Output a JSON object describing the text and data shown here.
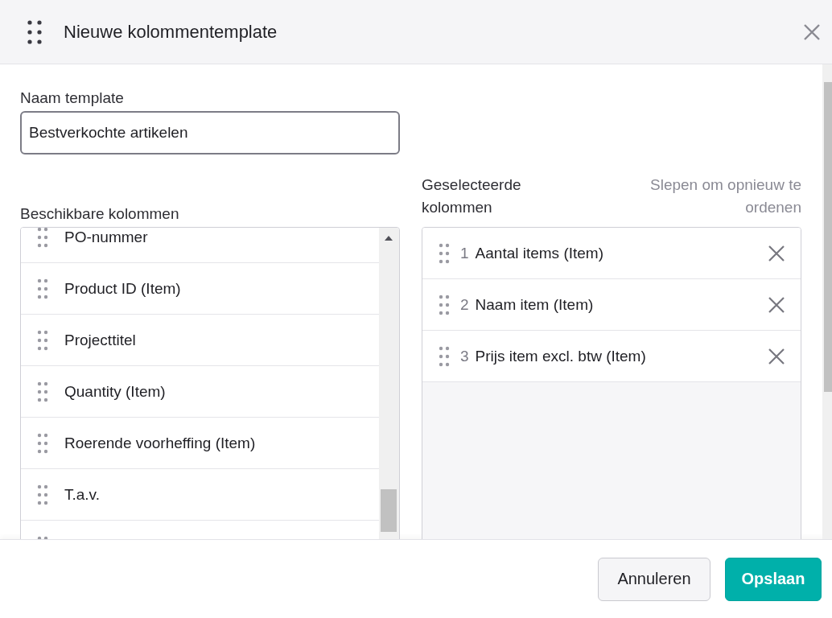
{
  "dialog": {
    "title": "Nieuwe kolommentemplate"
  },
  "template_name": {
    "label": "Naam template",
    "value": "Bestverkochte artikelen"
  },
  "available": {
    "label": "Beschikbare kolommen",
    "items": [
      {
        "label": "PO-nummer"
      },
      {
        "label": "Product ID (Item)"
      },
      {
        "label": "Projecttitel"
      },
      {
        "label": "Quantity (Item)"
      },
      {
        "label": "Roerende voorheffing (Item)"
      },
      {
        "label": "T.a.v."
      }
    ]
  },
  "selected": {
    "label": "Geselecteerde kolommen",
    "hint": "Slepen om opnieuw te ordenen",
    "items": [
      {
        "number": "1",
        "label": "Aantal items (Item)"
      },
      {
        "number": "2",
        "label": "Naam item (Item)"
      },
      {
        "number": "3",
        "label": "Prijs item excl. btw (Item)"
      }
    ]
  },
  "buttons": [
    {
      "label": "Annuleren",
      "kind": "secondary"
    },
    {
      "label": "Opslaan",
      "kind": "primary"
    }
  ]
}
